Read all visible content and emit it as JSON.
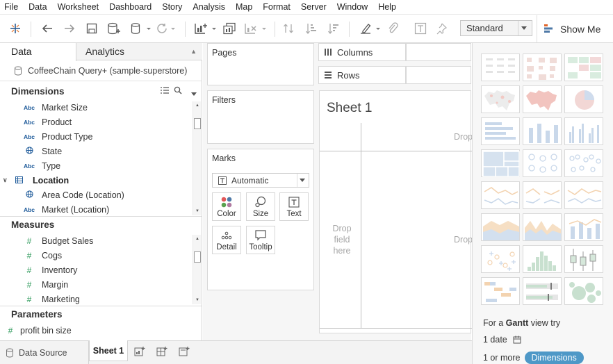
{
  "menu": [
    "File",
    "Data",
    "Worksheet",
    "Dashboard",
    "Story",
    "Analysis",
    "Map",
    "Format",
    "Server",
    "Window",
    "Help"
  ],
  "toolbar": {
    "view_size": "Standard",
    "show_me_label": "Show Me",
    "icons": [
      "tableau-logo-icon",
      "undo-icon",
      "redo-icon",
      "save-icon",
      "new-data-source-icon",
      "pause-updates-icon",
      "refresh-icon",
      "new-worksheet-icon",
      "duplicate-icon",
      "clear-icon",
      "swap-icon",
      "sort-ascending-icon",
      "sort-descending-icon",
      "highlight-icon",
      "group-icon",
      "labels-icon",
      "pin-icon"
    ]
  },
  "data_pane": {
    "tab_data": "Data",
    "tab_analytics": "Analytics",
    "datasource": "CoffeeChain Query+ (sample-superstore)",
    "dimensions_label": "Dimensions",
    "dimensions": [
      {
        "type": "Abc",
        "name": "Market Size"
      },
      {
        "type": "Abc",
        "name": "Product"
      },
      {
        "type": "Abc",
        "name": "Product Type"
      },
      {
        "type": "globe",
        "name": "State"
      },
      {
        "type": "Abc",
        "name": "Type"
      }
    ],
    "location_folder": "Location",
    "location_fields": [
      {
        "type": "globe",
        "name": "Area Code (Location)"
      },
      {
        "type": "Abc",
        "name": "Market (Location)"
      }
    ],
    "measures_label": "Measures",
    "measures": [
      "Budget Sales",
      "Cogs",
      "Inventory",
      "Margin",
      "Marketing"
    ],
    "parameters_label": "Parameters",
    "parameters": [
      "profit bin size"
    ]
  },
  "cards": {
    "pages": "Pages",
    "filters": "Filters",
    "marks": "Marks",
    "mark_type": "Automatic",
    "mark_buttons": [
      "Color",
      "Size",
      "Text",
      "Detail",
      "Tooltip"
    ]
  },
  "shelves": {
    "columns": "Columns",
    "rows": "Rows"
  },
  "sheet": {
    "title": "Sheet 1",
    "drop_top": "Drop",
    "drop_left": "Drop field here",
    "drop_center": "Drop"
  },
  "show_me": {
    "hint_prefix": "For a ",
    "hint_chart": "Gantt",
    "hint_suffix": " view try",
    "req_date": "1 date",
    "req_dims_prefix": "1 or more",
    "req_dims_pill": "Dimensions"
  },
  "bottom": {
    "datasource_tab": "Data Source",
    "sheet_tab": "Sheet 1"
  }
}
